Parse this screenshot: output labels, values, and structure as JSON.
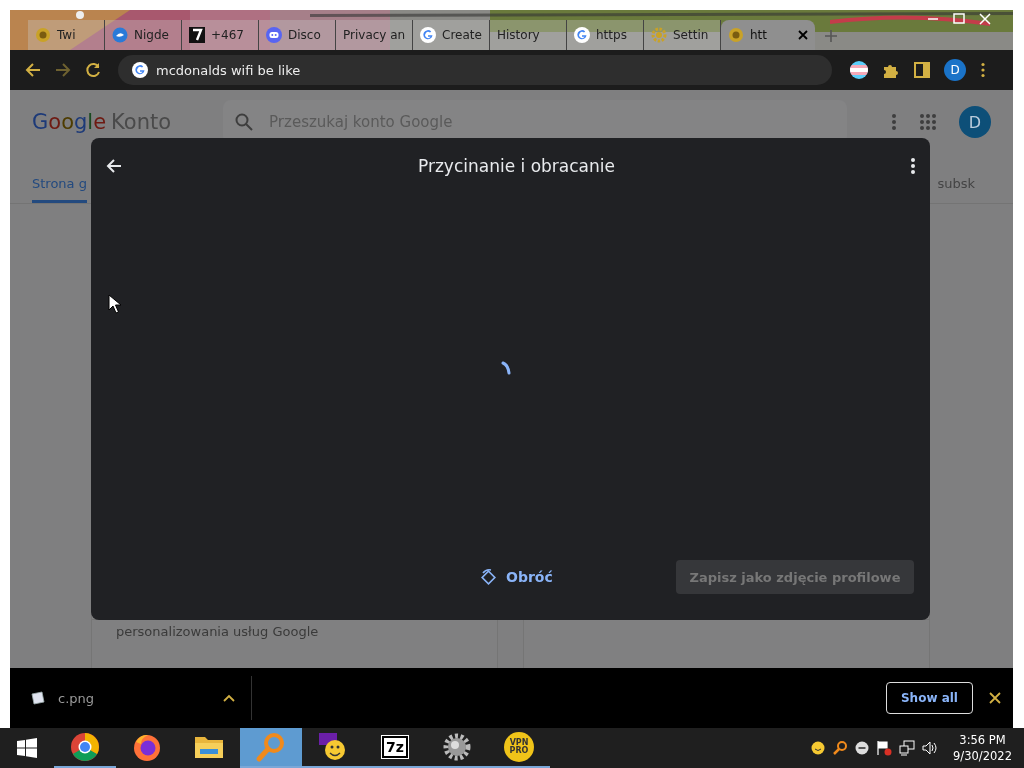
{
  "browser": {
    "tabs": [
      {
        "label": "Twi",
        "kind": "coin",
        "selected": false
      },
      {
        "label": "Nigde",
        "kind": "bird",
        "selected": false
      },
      {
        "label": "+467",
        "kind": "seven",
        "selected": false
      },
      {
        "label": "Disco",
        "kind": "discord",
        "selected": false
      },
      {
        "label": "Privacy an",
        "kind": "plain",
        "selected": false
      },
      {
        "label": "Create",
        "kind": "google",
        "selected": false
      },
      {
        "label": "History",
        "kind": "plain",
        "selected": false
      },
      {
        "label": "https",
        "kind": "google",
        "selected": false
      },
      {
        "label": "Settin",
        "kind": "gear",
        "selected": false
      },
      {
        "label": "htt",
        "kind": "coin",
        "selected": true
      }
    ],
    "address": "mcdonalds wifi be like",
    "profile_initial": "D"
  },
  "page": {
    "logo": "Google",
    "brand": "Konto",
    "search_placeholder": "Przeszukaj konto Google",
    "avatar": "D",
    "nav_tabs": [
      {
        "label": "Strona g",
        "selected": true
      },
      {
        "label": "subsk",
        "selected": false
      }
    ],
    "card_text": "personalizowania usług Google"
  },
  "dialog": {
    "title": "Przycinanie i obracanie",
    "loading": true,
    "rotate_button": "Obróć",
    "save_button": {
      "label": "Zapisz jako zdjęcie profilowe",
      "disabled": true
    }
  },
  "downloads": {
    "items": [
      {
        "name": "c.png"
      }
    ],
    "show_all": "Show all"
  },
  "taskbar": {
    "apps": [
      {
        "kind": "chrome",
        "selected": false,
        "running": true
      },
      {
        "kind": "firefox",
        "selected": false,
        "running": false
      },
      {
        "kind": "folder",
        "selected": false,
        "running": false
      },
      {
        "kind": "magnifier",
        "selected": true,
        "running": true
      },
      {
        "kind": "yahoo",
        "selected": false,
        "running": true
      },
      {
        "kind": "archiver",
        "label": "7z",
        "selected": false,
        "running": true
      },
      {
        "kind": "gear",
        "selected": false,
        "running": true
      },
      {
        "kind": "vpn",
        "label": "VPN PRO",
        "selected": false,
        "running": true
      }
    ],
    "time": "3:56 PM",
    "date": "9/30/2022"
  }
}
